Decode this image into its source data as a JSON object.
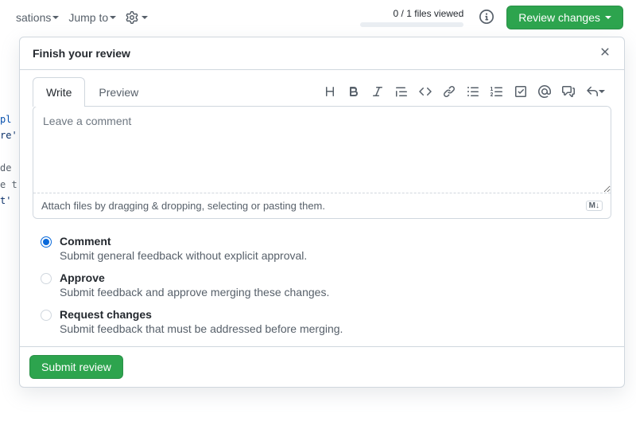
{
  "topbar": {
    "conversations_label": "sations",
    "jumpto_label": "Jump to",
    "files_viewed": "0 / 1 files viewed",
    "review_button": "Review changes"
  },
  "panel": {
    "title": "Finish your review"
  },
  "editor": {
    "tabs": {
      "write": "Write",
      "preview": "Preview"
    },
    "placeholder": "Leave a comment",
    "attach_hint": "Attach files by dragging & dropping, selecting or pasting them.",
    "md_badge": "M↓"
  },
  "options": [
    {
      "key": "comment",
      "title": "Comment",
      "desc": "Submit general feedback without explicit approval.",
      "checked": true
    },
    {
      "key": "approve",
      "title": "Approve",
      "desc": "Submit feedback and approve merging these changes.",
      "checked": false
    },
    {
      "key": "request",
      "title": "Request changes",
      "desc": "Submit feedback that must be addressed before merging.",
      "checked": false
    }
  ],
  "footer": {
    "submit_label": "Submit review"
  },
  "bg": {
    "l1": "pl",
    "l2": "re'",
    "l5": "t'"
  }
}
